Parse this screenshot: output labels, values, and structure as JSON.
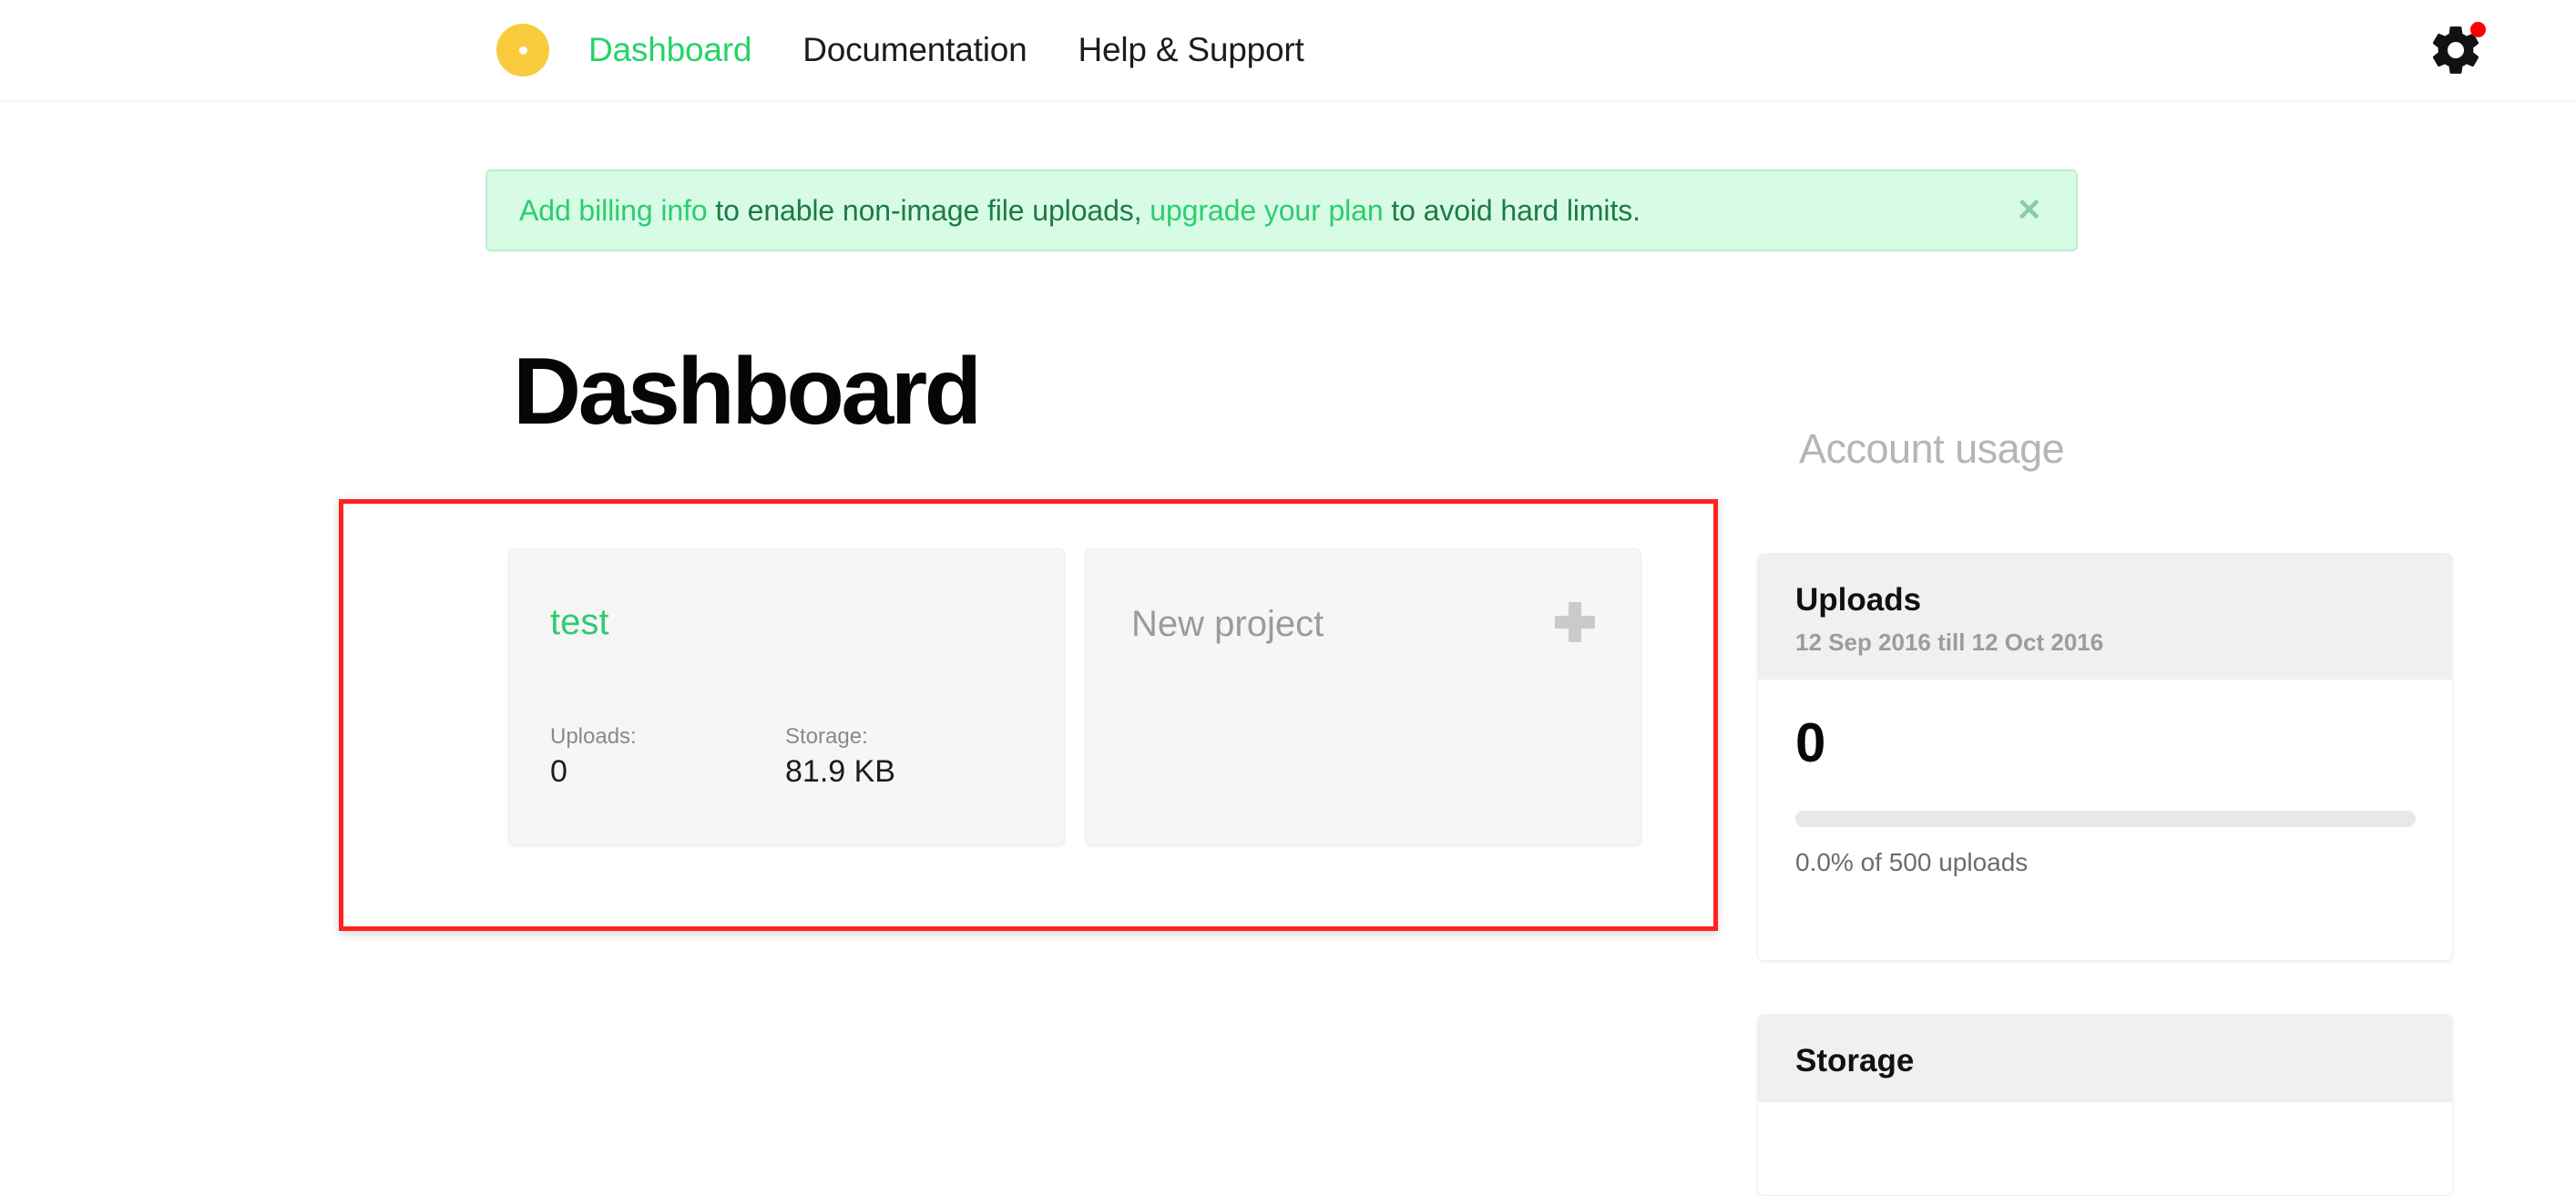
{
  "nav": {
    "logo_icon": "circle-logo-icon",
    "links": [
      {
        "label": "Dashboard",
        "active": true
      },
      {
        "label": "Documentation",
        "active": false
      },
      {
        "label": "Help & Support",
        "active": false
      }
    ],
    "settings_icon": "gear-icon",
    "settings_badge": true,
    "accent_color": "#25d366",
    "logo_color": "#f8cb3d",
    "badge_color": "#ff0000"
  },
  "banner": {
    "link1": "Add billing info",
    "mid_text": " to enable non-image file uploads, ",
    "link2": "upgrade your plan",
    "end_text": " to avoid hard limits.",
    "close_label": "✕",
    "background": "#d7fbe4",
    "text_color": "#1e7a46",
    "link_color": "#2ecc71"
  },
  "main": {
    "page_title": "Dashboard",
    "projects": [
      {
        "name": "test",
        "stats": [
          {
            "label": "Uploads:",
            "value": "0"
          },
          {
            "label": "Storage:",
            "value": "81.9 KB"
          }
        ]
      }
    ],
    "new_project": {
      "label": "New project",
      "icon": "plus-icon"
    }
  },
  "sidebar": {
    "title": "Account usage",
    "cards": [
      {
        "title": "Uploads",
        "subtitle": "12 Sep 2016 till 12 Oct 2016",
        "value": "0",
        "progress_percent": 0,
        "caption": "0.0% of 500 uploads"
      },
      {
        "title": "Storage"
      }
    ]
  },
  "annotation": {
    "color": "#ff2020"
  }
}
